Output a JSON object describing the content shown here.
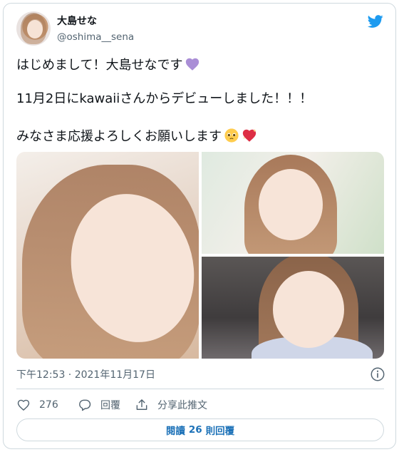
{
  "author": {
    "display_name": "大島せな",
    "username": "@oshima__sena",
    "avatar_icon": "avatar-photo"
  },
  "tweet": {
    "lines": [
      "はじめまして！大島せなです",
      "11月2日にkawaiiさんからデビューしました！！！",
      "みなさま応援よろしくお願いします"
    ],
    "emojis": [
      "purple-heart-icon",
      "pleading-face-icon",
      "sparkling-heart-icon"
    ],
    "timestamp": "下午12:53 · 2021年11月17日",
    "images_count": 3
  },
  "actions": {
    "like_count": "276",
    "reply_label": "回覆",
    "share_label": "分享此推文"
  },
  "read_replies": {
    "prefix": "閱讀",
    "count": "26",
    "suffix": "則回覆"
  },
  "colors": {
    "twitter_blue": "#1d9bf0",
    "link_text": "#1d72b8",
    "secondary_text": "#536471",
    "border": "#cfd9de"
  }
}
